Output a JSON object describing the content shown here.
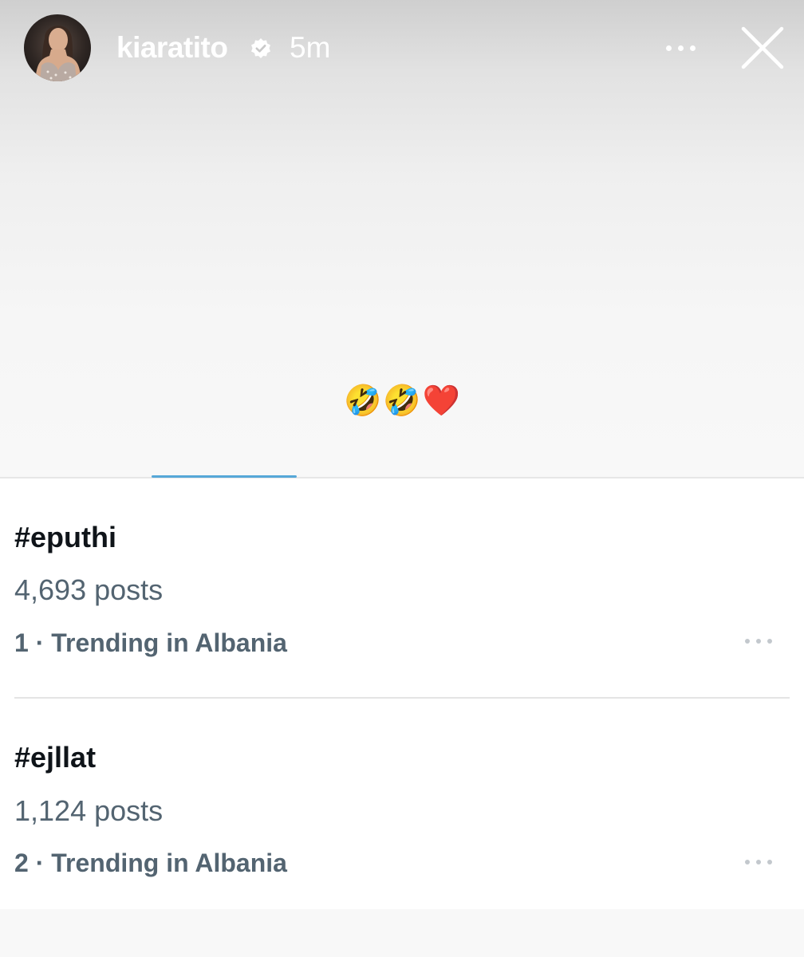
{
  "story": {
    "username": "kiaratito",
    "verified": true,
    "timestamp": "5m",
    "caption_emojis": [
      "🤣",
      "🤣",
      "❤️"
    ]
  },
  "icons": {
    "verified": "verified-badge-icon",
    "more": "more-horizontal-icon",
    "close": "close-icon"
  },
  "trends": [
    {
      "tag": "#eputhi",
      "posts": "4,693 posts",
      "rank_line": "1 · Trending in Albania"
    },
    {
      "tag": "#ejllat",
      "posts": "1,124 posts",
      "rank_line": "2 · Trending in Albania"
    }
  ],
  "colors": {
    "primary_text": "#0f1419",
    "secondary_text": "#536471",
    "tab_indicator": "#56a8d8",
    "header_text": "#ffffff"
  }
}
